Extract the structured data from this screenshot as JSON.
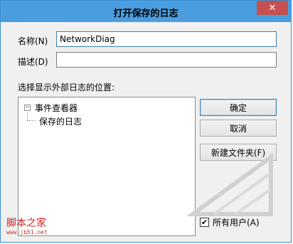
{
  "dialog": {
    "title": "打开保存的日志",
    "close_glyph": "✕"
  },
  "form": {
    "name_label": "名称(N)",
    "name_value": "NetworkDiag",
    "desc_label": "描述(D)",
    "desc_value": ""
  },
  "location": {
    "label": "选择显示外部日志的位置:"
  },
  "tree": {
    "expander": "−",
    "root_label": "事件查看器",
    "child_label": "保存的日志"
  },
  "buttons": {
    "ok": "确定",
    "cancel": "取消",
    "new_folder": "新建文件夹(F)"
  },
  "all_users": {
    "label": "所有用户(A)",
    "checked_glyph": "✔"
  },
  "watermark": {
    "brand": "脚本之家",
    "url": "www.jb51.net"
  }
}
